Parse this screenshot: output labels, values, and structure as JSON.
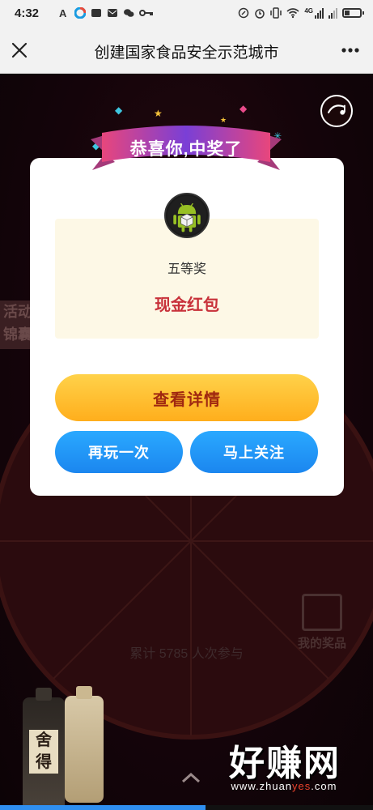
{
  "status_bar": {
    "time": "4:32",
    "network_label": "4G",
    "colors": {
      "bg": "#f2f2f2"
    }
  },
  "title_bar": {
    "title": "创建国家食品安全示范城市",
    "close_icon": "close-icon",
    "more_icon": "more-icon"
  },
  "background": {
    "side_tag": "活动\n锦囊",
    "participation_count": "累计 5785 人次参与",
    "my_prizes_label": "我的奖品",
    "bottle_label": "舍得"
  },
  "modal": {
    "ribbon_text": "恭喜你,中奖了",
    "prize_level": "五等奖",
    "prize_name": "现金红包",
    "detail_button": "查看详情",
    "play_again_button": "再玩一次",
    "follow_button": "马上关注",
    "colors": {
      "prize_name": "#c8313a",
      "detail_btn": "#ffbe2e",
      "blue_btn": "#1b86ef"
    }
  },
  "watermark": {
    "main": "好赚网",
    "sub_prefix": "www.zhuan",
    "sub_highlight": "yes",
    "sub_suffix": ".com"
  },
  "page_progress": 0.55
}
